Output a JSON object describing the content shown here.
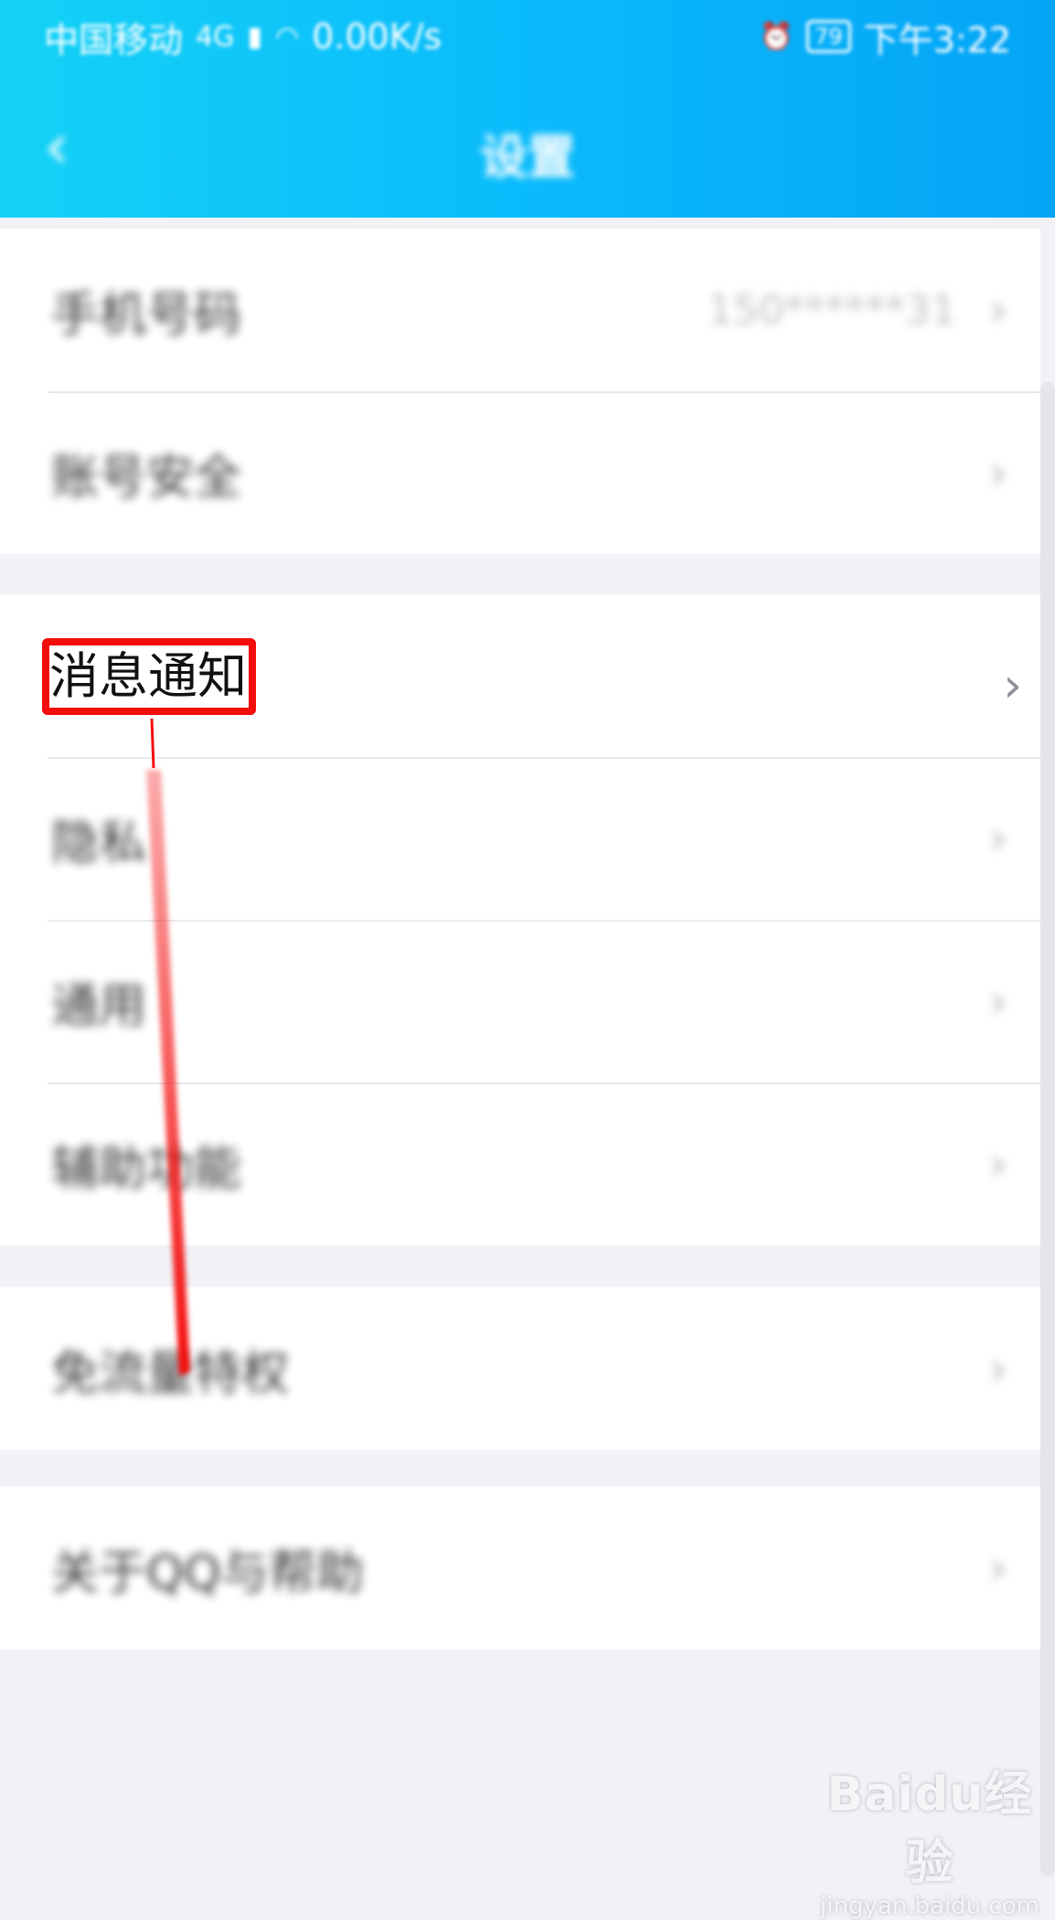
{
  "status_bar": {
    "carrier": "中国移动",
    "network": "4G",
    "speed": "0.00K/s",
    "battery": "79",
    "time": "下午3:22"
  },
  "header": {
    "title": "设置",
    "back_icon": "chevron-left-icon",
    "background_gradient": [
      "#14d2f6",
      "#04a4f6"
    ]
  },
  "groups": [
    {
      "rows": [
        {
          "label": "手机号码",
          "value": "150******31"
        },
        {
          "label": "账号安全",
          "value": ""
        }
      ]
    },
    {
      "rows": [
        {
          "label": "消息通知",
          "value": "",
          "highlighted": true
        },
        {
          "label": "隐私",
          "value": ""
        },
        {
          "label": "通用",
          "value": ""
        },
        {
          "label": "辅助功能",
          "value": ""
        }
      ]
    },
    {
      "rows": [
        {
          "label": "免流量特权",
          "value": ""
        }
      ]
    },
    {
      "rows": [
        {
          "label": "关于QQ与帮助",
          "value": ""
        }
      ]
    }
  ],
  "annotation": {
    "color": "#f40d0d"
  },
  "watermark": {
    "brand": "Baidu经验",
    "url": "jingyan.baidu.com"
  }
}
